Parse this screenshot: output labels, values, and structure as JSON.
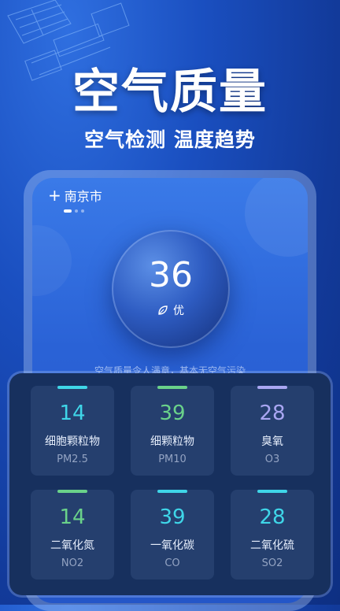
{
  "hero": {
    "title": "空气质量",
    "subtitle": "空气检测 温度趋势"
  },
  "screen": {
    "city": "南京市",
    "add_icon": "plus-icon",
    "page_indicator": {
      "count": 3,
      "active": 1
    },
    "aqi": {
      "value": "36",
      "level": "优",
      "level_icon": "leaf-icon"
    },
    "description": "空气质量令人满意，基本无空气污染"
  },
  "pollutants": [
    {
      "value": "14",
      "name": "细胞颗粒物",
      "code": "PM2.5",
      "color": "#3fd6e8"
    },
    {
      "value": "39",
      "name": "细颗粒物",
      "code": "PM10",
      "color": "#6ad28a"
    },
    {
      "value": "28",
      "name": "臭氧",
      "code": "O3",
      "color": "#a9a6f2"
    },
    {
      "value": "14",
      "name": "二氧化氮",
      "code": "NO2",
      "color": "#6ad28a"
    },
    {
      "value": "39",
      "name": "一氧化碳",
      "code": "CO",
      "color": "#3fd6e8"
    },
    {
      "value": "28",
      "name": "二氧化硫",
      "code": "SO2",
      "color": "#3fd6e8"
    }
  ]
}
